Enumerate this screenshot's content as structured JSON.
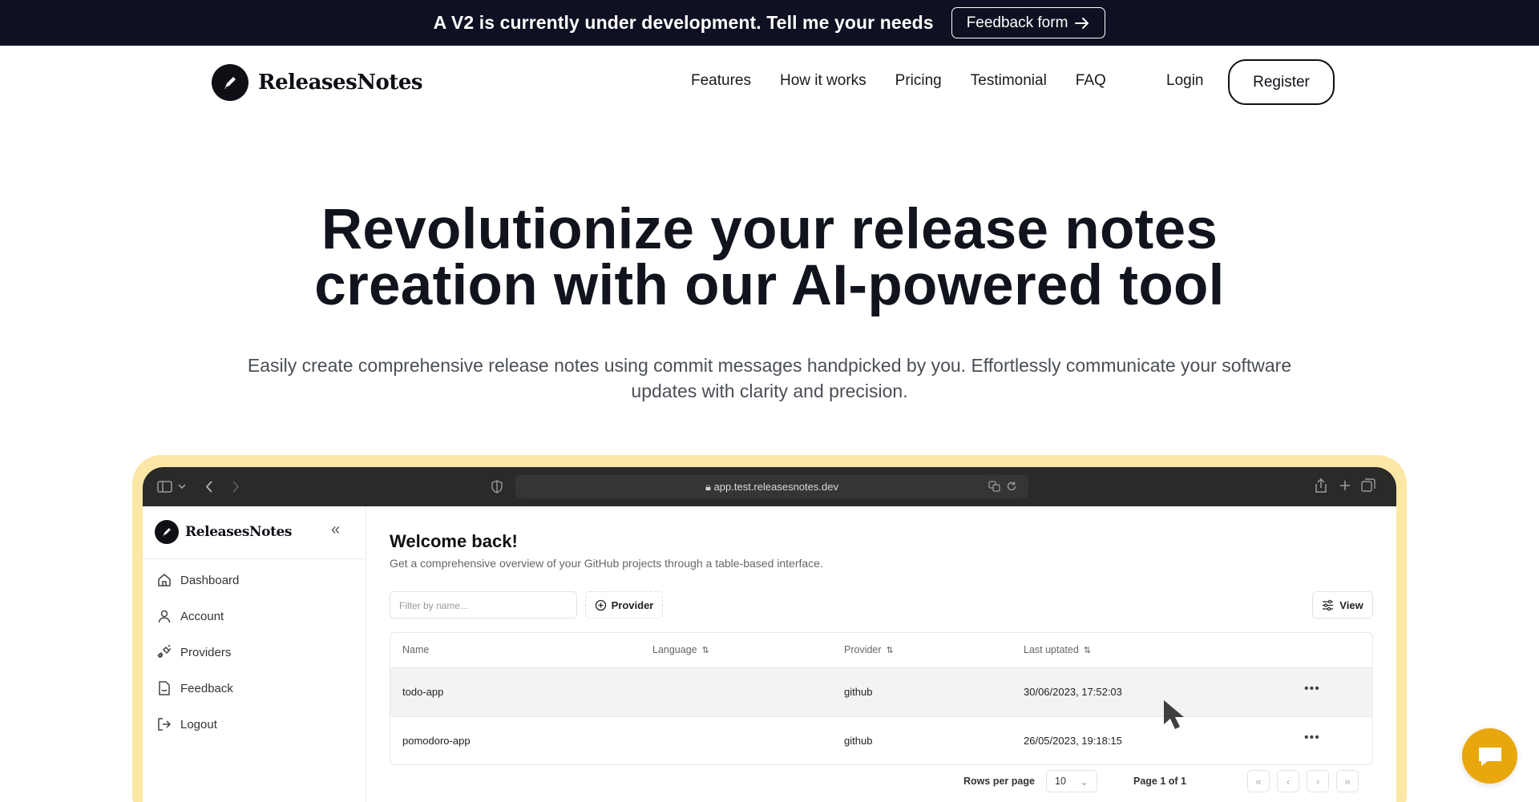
{
  "announcement": {
    "text": "A V2 is currently under development. Tell me your needs",
    "button_label": "Feedback form"
  },
  "nav": {
    "brand": "ReleasesNotes",
    "links": [
      "Features",
      "How it works",
      "Pricing",
      "Testimonial",
      "FAQ"
    ],
    "login": "Login",
    "register": "Register"
  },
  "hero": {
    "title_line1": "Revolutionize your release notes",
    "title_line2": "creation with our AI-powered tool",
    "subtitle_line1": "Easily create comprehensive release notes using commit messages handpicked by you. Effortlessly communicate your software",
    "subtitle_line2": "updates with clarity and precision."
  },
  "preview": {
    "url": "app.test.releasesnotes.dev",
    "app_brand": "ReleasesNotes",
    "collapse_glyph": "«",
    "sidebar": [
      "Dashboard",
      "Account",
      "Providers",
      "Feedback",
      "Logout"
    ],
    "welcome_title": "Welcome back!",
    "welcome_sub": "Get a comprehensive overview of your GitHub projects through a table-based interface.",
    "filter_placeholder": "Filter by name...",
    "provider_button": "Provider",
    "view_button": "View",
    "columns": [
      "Name",
      "Language",
      "Provider",
      "Last uptated"
    ],
    "rows": [
      {
        "name": "todo-app",
        "language": "",
        "provider": "github",
        "updated": "30/06/2023, 17:52:03"
      },
      {
        "name": "pomodoro-app",
        "language": "",
        "provider": "github",
        "updated": "26/05/2023, 19:18:15"
      }
    ],
    "rows_per_page_label": "Rows per page",
    "rows_per_page_value": "10",
    "page_info": "Page 1 of 1",
    "pager_glyphs": [
      "«",
      "‹",
      "›",
      "»"
    ]
  },
  "colors": {
    "announce_bg": "#0f1021",
    "frame_accent": "#fde7a6",
    "chat_button": "#e9a70e"
  }
}
